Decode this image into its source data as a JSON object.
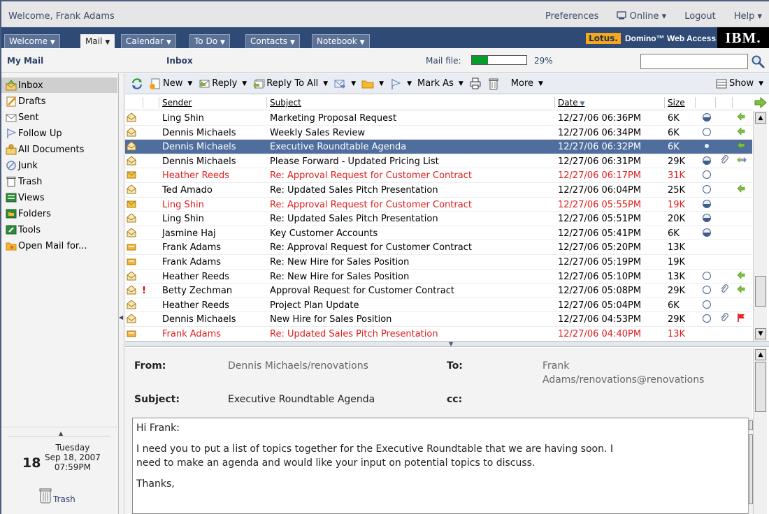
{
  "topbar": {
    "welcome": "Welcome, Frank Adams",
    "preferences": "Preferences",
    "online": "Online ▾",
    "logout": "Logout",
    "help": "Help ▾"
  },
  "tabs": [
    {
      "label": "Welcome",
      "active": false
    },
    {
      "label": "Mail",
      "active": true
    },
    {
      "label": "Calendar",
      "active": false
    },
    {
      "label": "To Do",
      "active": false
    },
    {
      "label": "Contacts",
      "active": false
    },
    {
      "label": "Notebook",
      "active": false
    }
  ],
  "brand": {
    "lotus": "Lotus.",
    "product": "Domino™ Web Access",
    "ibm": "IBM."
  },
  "location": {
    "section": "My Mail",
    "folder": "Inbox",
    "mailfile_label": "Mail file:",
    "mailfile_pct": "29%",
    "mailfile_fraction": 0.29,
    "search_value": ""
  },
  "nav": [
    {
      "label": "Inbox",
      "icon": "inbox-icon",
      "selected": true
    },
    {
      "label": "Drafts",
      "icon": "drafts-icon",
      "selected": false
    },
    {
      "label": "Sent",
      "icon": "sent-icon",
      "selected": false
    },
    {
      "label": "Follow Up",
      "icon": "flag-icon",
      "selected": false
    },
    {
      "label": "All Documents",
      "icon": "all-documents-icon",
      "selected": false
    },
    {
      "label": "Junk",
      "icon": "junk-icon",
      "selected": false
    },
    {
      "label": "Trash",
      "icon": "trash-icon",
      "selected": false
    },
    {
      "label": "Views",
      "icon": "views-icon",
      "selected": false
    },
    {
      "label": "Folders",
      "icon": "folders-icon",
      "selected": false
    },
    {
      "label": "Tools",
      "icon": "tools-icon",
      "selected": false
    },
    {
      "label": "Open Mail for...",
      "icon": "open-mail-icon",
      "selected": false
    }
  ],
  "datebox": {
    "day": "18",
    "weekday": "Tuesday",
    "date": "Sep 18, 2007",
    "time": "07:59PM",
    "trash": "Trash"
  },
  "toolbar": {
    "new": "New",
    "reply": "Reply",
    "reply_all": "Reply To All",
    "mark_as": "Mark As",
    "more": "More",
    "show": "Show"
  },
  "columns": {
    "sender": "Sender",
    "subject": "Subject",
    "date": "Date",
    "size": "Size"
  },
  "messages": [
    {
      "sender": "Ling Shin",
      "subject": "Marketing Proposal Request",
      "date": "12/27/06 06:36PM",
      "size": "6K",
      "status": "read",
      "attach": false,
      "action": "reply",
      "red": false,
      "selected": false,
      "important": false,
      "icon": "read-icon"
    },
    {
      "sender": "Dennis Michaels",
      "subject": "Weekly Sales Review",
      "date": "12/27/06 06:34PM",
      "size": "6K",
      "status": "unread",
      "attach": false,
      "action": "reply",
      "red": false,
      "selected": false,
      "important": false,
      "icon": "read-icon"
    },
    {
      "sender": "Dennis Michaels",
      "subject": "Executive Roundtable Agenda",
      "date": "12/27/06 06:32PM",
      "size": "6K",
      "status": "read",
      "attach": false,
      "action": "reply",
      "red": false,
      "selected": true,
      "important": false,
      "icon": "read-icon"
    },
    {
      "sender": "Dennis Michaels",
      "subject": "Please Forward - Updated Pricing List",
      "date": "12/27/06 06:31PM",
      "size": "29K",
      "status": "read",
      "attach": true,
      "action": "replyforward",
      "red": false,
      "selected": false,
      "important": false,
      "icon": "read-icon"
    },
    {
      "sender": "Heather Reeds",
      "subject": "Re: Approval Request for Customer Contract",
      "date": "12/27/06 06:17PM",
      "size": "31K",
      "status": "unread",
      "attach": false,
      "action": "",
      "red": true,
      "selected": false,
      "important": false,
      "icon": "unread-icon"
    },
    {
      "sender": "Ted Amado",
      "subject": "Re: Updated Sales Pitch Presentation",
      "date": "12/27/06 06:04PM",
      "size": "25K",
      "status": "unread",
      "attach": false,
      "action": "reply",
      "red": false,
      "selected": false,
      "important": false,
      "icon": "read-icon"
    },
    {
      "sender": "Ling Shin",
      "subject": "Re: Approval Request for Customer Contract",
      "date": "12/27/06 05:55PM",
      "size": "19K",
      "status": "read",
      "attach": false,
      "action": "",
      "red": true,
      "selected": false,
      "important": false,
      "icon": "unread-icon"
    },
    {
      "sender": "Ling Shin",
      "subject": "Re: Updated Sales Pitch Presentation",
      "date": "12/27/06 05:51PM",
      "size": "20K",
      "status": "read",
      "attach": false,
      "action": "",
      "red": false,
      "selected": false,
      "important": false,
      "icon": "read-icon"
    },
    {
      "sender": "Jasmine Haj",
      "subject": "Key Customer Accounts",
      "date": "12/27/06 05:41PM",
      "size": "6K",
      "status": "read",
      "attach": false,
      "action": "",
      "red": false,
      "selected": false,
      "important": false,
      "icon": "read-icon"
    },
    {
      "sender": "Frank Adams",
      "subject": "Re: Approval Request for Customer Contract",
      "date": "12/27/06 05:20PM",
      "size": "13K",
      "status": "",
      "attach": false,
      "action": "",
      "red": false,
      "selected": false,
      "important": false,
      "icon": "sent-msg-icon"
    },
    {
      "sender": "Frank Adams",
      "subject": "Re: New Hire for Sales Position",
      "date": "12/27/06 05:19PM",
      "size": "19K",
      "status": "",
      "attach": false,
      "action": "",
      "red": false,
      "selected": false,
      "important": false,
      "icon": "sent-msg-icon"
    },
    {
      "sender": "Heather Reeds",
      "subject": "Re: New Hire for Sales Position",
      "date": "12/27/06 05:10PM",
      "size": "13K",
      "status": "unread",
      "attach": false,
      "action": "reply",
      "red": false,
      "selected": false,
      "important": false,
      "icon": "read-icon"
    },
    {
      "sender": "Betty Zechman",
      "subject": "Approval Request for Customer Contract",
      "date": "12/27/06 05:08PM",
      "size": "29K",
      "status": "unread",
      "attach": true,
      "action": "reply",
      "red": false,
      "selected": false,
      "important": true,
      "icon": "read-icon"
    },
    {
      "sender": "Heather Reeds",
      "subject": "Project Plan Update",
      "date": "12/27/06 05:04PM",
      "size": "6K",
      "status": "unread",
      "attach": false,
      "action": "",
      "red": false,
      "selected": false,
      "important": false,
      "icon": "read-icon"
    },
    {
      "sender": "Dennis Michaels",
      "subject": "New Hire for Sales Position",
      "date": "12/27/06 04:53PM",
      "size": "29K",
      "status": "unread",
      "attach": true,
      "action": "flag",
      "red": false,
      "selected": false,
      "important": false,
      "icon": "read-icon"
    },
    {
      "sender": "Frank Adams",
      "subject": "Re: Updated Sales Pitch Presentation",
      "date": "12/27/06 04:40PM",
      "size": "13K",
      "status": "",
      "attach": false,
      "action": "",
      "red": true,
      "selected": false,
      "important": false,
      "icon": "sent-msg-icon"
    }
  ],
  "preview": {
    "from_label": "From:",
    "from": "Dennis Michaels/renovations",
    "to_label": "To:",
    "to_line1": "Frank",
    "to_line2": "Adams/renovations@renovations",
    "subject_label": "Subject:",
    "subject": "Executive Roundtable Agenda",
    "cc_label": "cc:",
    "body": {
      "greeting": "Hi Frank:",
      "para1_line1": "I need you to put a list of topics together for the Executive Roundtable that we are having soon. I",
      "para1_line2": "need to make an agenda and would like your input on potential topics to discuss.",
      "closing": "Thanks,"
    }
  },
  "colors": {
    "accent": "#2f4a74",
    "selected_row": "#4f6e9e",
    "red_text": "#e11d1d",
    "brand": "#f5a81e"
  }
}
